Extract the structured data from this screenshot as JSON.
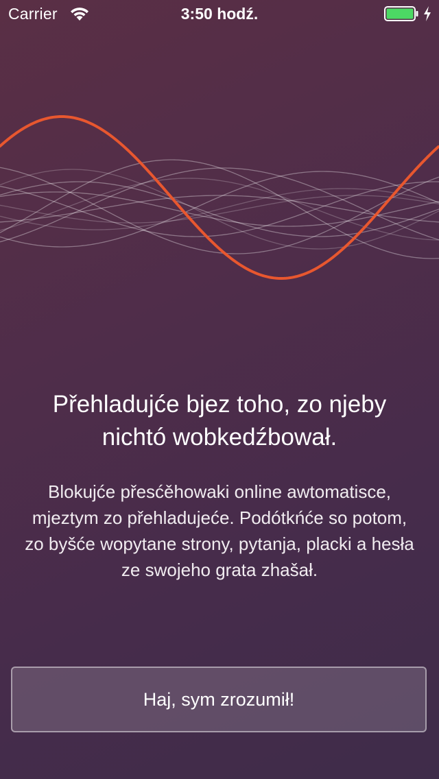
{
  "status_bar": {
    "carrier": "Carrier",
    "time": "3:50 hodź.",
    "battery_color": "#4cd964"
  },
  "onboarding": {
    "headline": "Přehladujće bjez toho, zo njeby nichtó wobkedźbował.",
    "description": "Blokujće přesćěhowaki online awtomatisce, mjeztym zo přehladujeće. Podótkńće so potom, zo byšće wopytane strony, pytanja, placki a hesła ze swojeho grata zhašał.",
    "button_label": "Haj, sym zrozumił!"
  },
  "colors": {
    "accent_wave": "#e8572f",
    "background_top": "#5a2f45",
    "background_bottom": "#3f2c4a"
  },
  "icons": [
    "wifi-icon",
    "battery-icon",
    "charging-icon"
  ]
}
